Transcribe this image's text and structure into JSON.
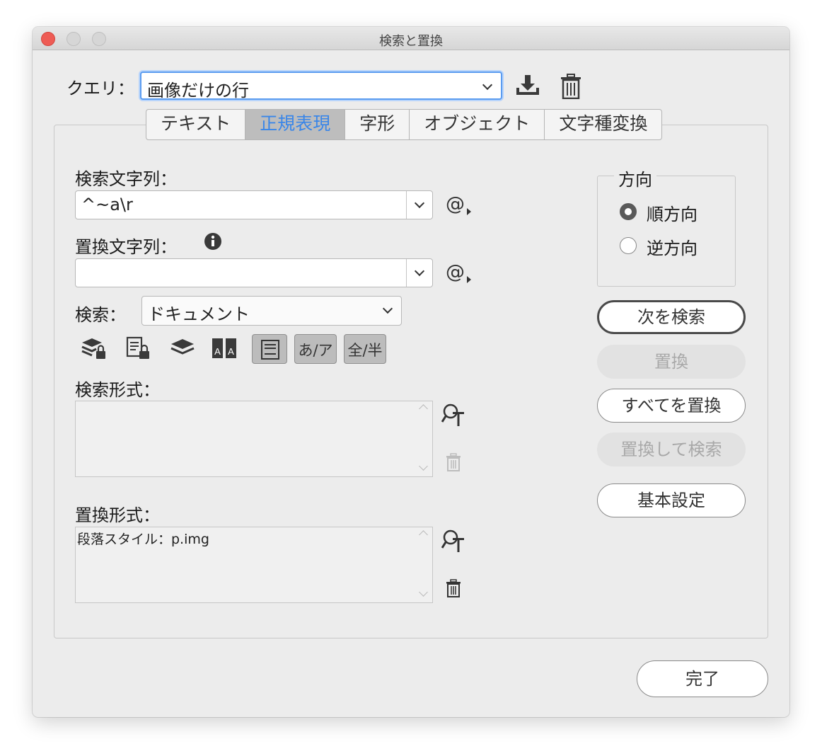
{
  "window": {
    "title": "検索と置換"
  },
  "query": {
    "label": "クエリ：",
    "value": "画像だけの行",
    "save_icon": "save-query-icon",
    "delete_icon": "trash-icon"
  },
  "tabs": [
    {
      "label": "テキスト",
      "active": false
    },
    {
      "label": "正規表現",
      "active": true
    },
    {
      "label": "字形",
      "active": false
    },
    {
      "label": "オブジェクト",
      "active": false
    },
    {
      "label": "文字種変換",
      "active": false
    }
  ],
  "find": {
    "label": "検索文字列：",
    "value": "^~a\\r",
    "special_char_icon": "@"
  },
  "replace": {
    "label": "置換文字列：",
    "value": "",
    "special_char_icon": "@"
  },
  "search": {
    "label": "検索：",
    "value": "ドキュメント"
  },
  "options": {
    "kana_label": "あ/ア",
    "width_label": "全/半"
  },
  "find_format": {
    "label": "検索形式：",
    "value": ""
  },
  "replace_format": {
    "label": "置換形式：",
    "value": "段落スタイル：p.img"
  },
  "direction": {
    "label": "方向",
    "forward": "順方向",
    "backward": "逆方向",
    "selected": "forward"
  },
  "buttons": {
    "find_next": "次を検索",
    "change": "置換",
    "change_all": "すべてを置換",
    "change_find": "置換して検索",
    "fewer_options": "基本設定",
    "done": "完了"
  },
  "colors": {
    "accent": "#3a86e8",
    "focus": "#5b9cf0",
    "close": "#ee5c55"
  }
}
